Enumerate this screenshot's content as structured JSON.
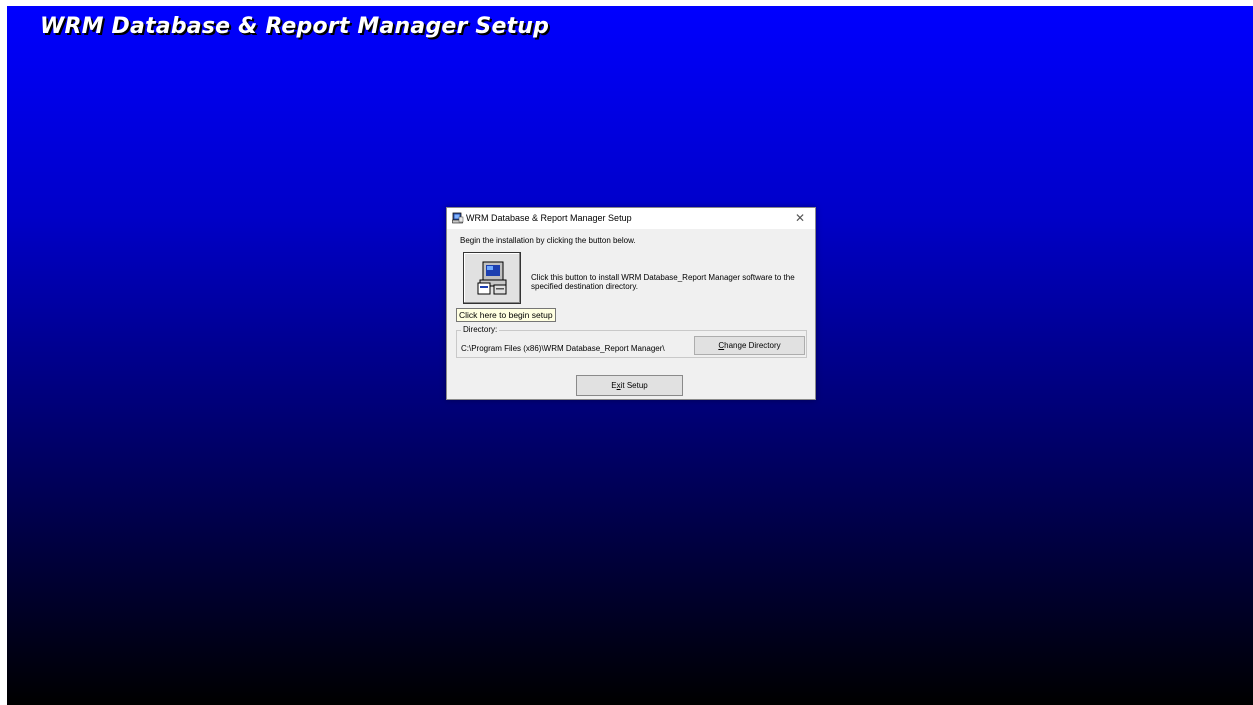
{
  "backdrop": {
    "title": "WRM Database & Report Manager Setup"
  },
  "dialog": {
    "title": "WRM Database & Report Manager Setup",
    "close_symbol": "✕",
    "instructions": "Begin the installation by clicking the button below.",
    "setup_button": {
      "icon": "computer-install-icon"
    },
    "setup_description": "Click this button to install WRM Database_Report Manager software to the specified destination directory.",
    "tooltip": "Click here to begin setup",
    "directory": {
      "label": "Directory:",
      "path": "C:\\Program Files (x86)\\WRM Database_Report Manager\\",
      "change_button": {
        "mnemonic": "C",
        "rest": "hange Directory"
      }
    },
    "exit_button": {
      "pre": "E",
      "mnemonic": "x",
      "post": "it Setup"
    }
  },
  "colors": {
    "backdrop_top": "#0000ff",
    "backdrop_bottom": "#000000",
    "dialog_bg": "#f0f0f0",
    "tooltip_bg": "#ffffe1"
  }
}
